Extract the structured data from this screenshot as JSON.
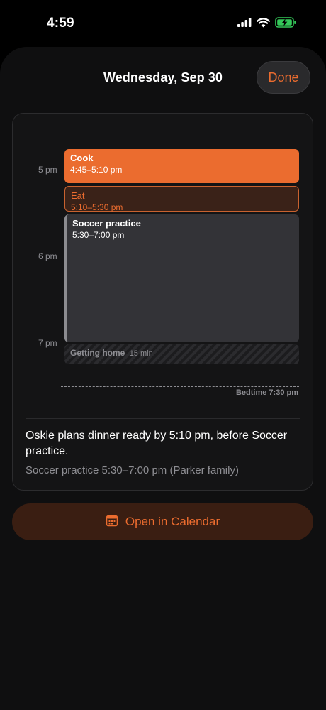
{
  "status_bar": {
    "time": "4:59",
    "icons": [
      "signal-icon",
      "wifi-icon",
      "battery-charging-icon"
    ]
  },
  "sheet": {
    "title": "Wednesday, Sep 30",
    "done_label": "Done"
  },
  "timeline": {
    "hour_labels": [
      "5 pm",
      "6 pm",
      "7 pm"
    ],
    "events": [
      {
        "title": "Cook",
        "time": "4:45–5:10 pm"
      },
      {
        "title": "Eat",
        "time": "5:10–5:30 pm"
      },
      {
        "title": "Soccer practice",
        "time": "5:30–7:00 pm"
      }
    ],
    "travel": {
      "title": "Getting home",
      "duration": "15 min"
    },
    "bedtime_label": "Bedtime 7:30 pm"
  },
  "summary": {
    "text": "Oskie plans dinner ready by 5:10 pm, before Soccer practice.",
    "detail": "Soccer practice 5:30–7:00 pm (Parker family)"
  },
  "open_calendar": {
    "label": "Open in Calendar",
    "icon": "calendar-icon"
  },
  "colors": {
    "accent": "#eb6c2f",
    "background": "#000000",
    "sheet": "#0f0f10"
  }
}
